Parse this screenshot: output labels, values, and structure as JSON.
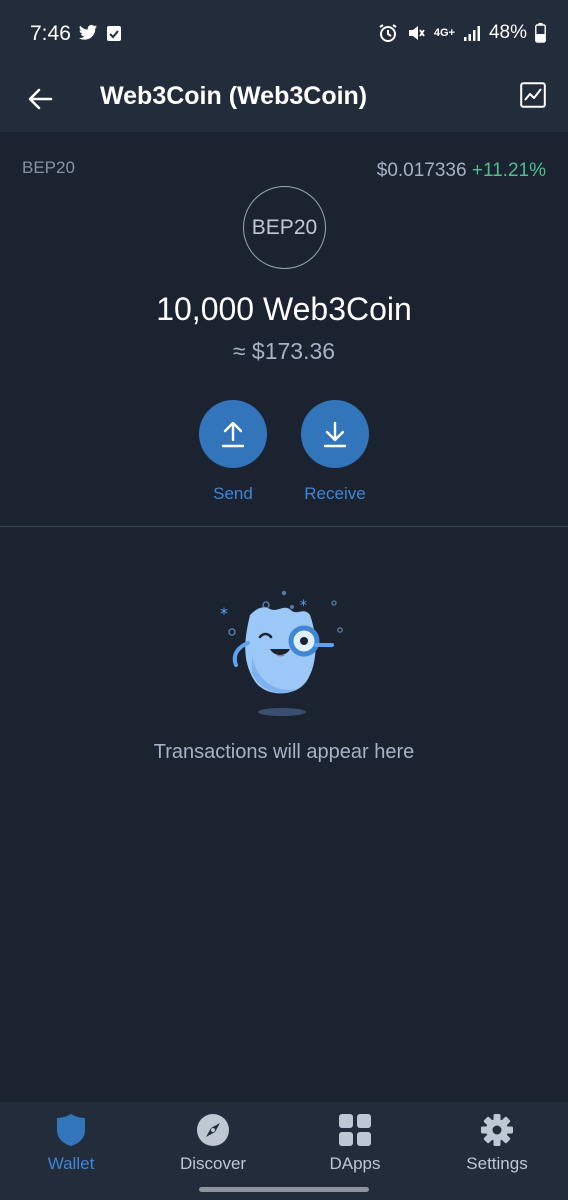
{
  "status_bar": {
    "time": "7:46",
    "battery": "48%",
    "network": "4G+"
  },
  "app_bar": {
    "title": "Web3Coin (Web3Coin)"
  },
  "token": {
    "network": "BEP20",
    "logo_text": "BEP20",
    "price": "$0.017336",
    "change": "+11.21%",
    "balance": "10,000 Web3Coin",
    "fiat_value": "≈ $173.36"
  },
  "actions": {
    "send_label": "Send",
    "receive_label": "Receive"
  },
  "empty_state": {
    "text": "Transactions will appear here"
  },
  "bottom_nav": {
    "items": [
      {
        "label": "Wallet",
        "icon": "shield-icon",
        "active": true
      },
      {
        "label": "Discover",
        "icon": "compass-icon",
        "active": false
      },
      {
        "label": "DApps",
        "icon": "grid-icon",
        "active": false
      },
      {
        "label": "Settings",
        "icon": "gear-icon",
        "active": false
      }
    ]
  },
  "colors": {
    "background": "#1b2230",
    "bar": "#232c3a",
    "accent": "#3375bb",
    "positive": "#4dbf8f"
  }
}
